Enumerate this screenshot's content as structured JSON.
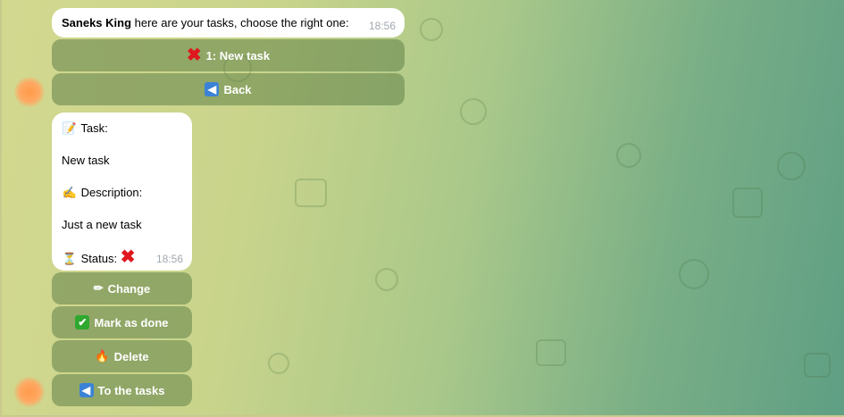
{
  "chat": {
    "message1": {
      "sender": "Saneks King",
      "text": " here are your tasks, choose the right one:",
      "time": "18:56"
    },
    "task_buttons": [
      {
        "icon": "cross-mark-icon",
        "label": "1: New task"
      },
      {
        "icon": "back-arrow-icon",
        "label": "Back"
      }
    ],
    "message2": {
      "task_label": "Task:",
      "task_value": "New task",
      "description_label": "Description:",
      "description_value": "Just a new task",
      "status_label": "Status:",
      "status_icon": "cross-mark-icon",
      "time": "18:56"
    },
    "action_buttons": [
      {
        "icon": "pencil-icon",
        "label": "Change"
      },
      {
        "icon": "check-mark-icon",
        "label": "Mark as done"
      },
      {
        "icon": "fire-icon",
        "label": "Delete"
      },
      {
        "icon": "back-arrow-icon",
        "label": "To the tasks"
      }
    ]
  },
  "colors": {
    "bubble": "#ffffff",
    "button": "#6a8a4e",
    "cross": "#e0171e",
    "check": "#2ea82e",
    "back": "#3b82d6",
    "time": "#a0a8b0"
  }
}
